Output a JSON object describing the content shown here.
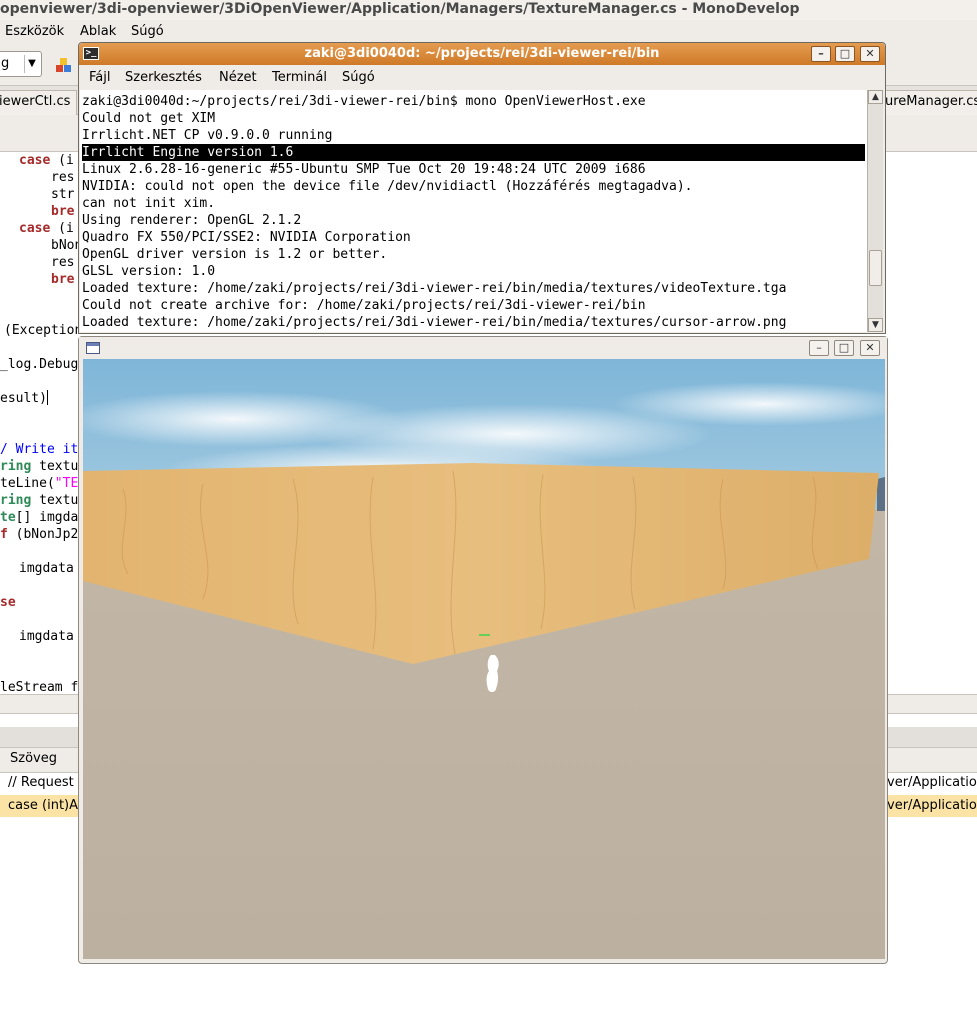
{
  "monodevelop": {
    "title": "openviewer/3di-openviewer/3DiOpenViewer/Application/Managers/TextureManager.cs - MonoDevelop",
    "menu": [
      "Eszközök",
      "Ablak",
      "Súgó"
    ],
    "config_combo": "g",
    "tabs": {
      "left": "iewerCtl.cs",
      "right": "ureManager.cs"
    },
    "pad": {
      "column": "Szöveg",
      "rows": [
        {
          "text": "// Request t",
          "right": "ver/Application"
        },
        {
          "text": "case (int)A",
          "right": "ver/Application"
        }
      ]
    }
  },
  "terminal": {
    "title": "zaki@3di0040d: ~/projects/rei/3di-viewer-rei/bin",
    "menu": [
      "Fájl",
      "Szerkesztés",
      "Nézet",
      "Terminál",
      "Súgó"
    ],
    "lines": [
      "zaki@3di0040d:~/projects/rei/3di-viewer-rei/bin$ mono OpenViewerHost.exe",
      "Could not get XIM",
      "Irrlicht.NET CP v0.9.0.0 running",
      "Irrlicht Engine version 1.6",
      "Linux 2.6.28-16-generic #55-Ubuntu SMP Tue Oct 20 19:48:24 UTC 2009 i686",
      "NVIDIA: could not open the device file /dev/nvidiactl (Hozzáférés megtagadva).",
      "can not init xim.",
      "Using renderer: OpenGL 2.1.2",
      "Quadro FX 550/PCI/SSE2: NVIDIA Corporation",
      "OpenGL driver version is 1.2 or better.",
      "GLSL version: 1.0",
      "Loaded texture: /home/zaki/projects/rei/3di-viewer-rei/bin/media/textures/videoTexture.tga",
      "Could not create archive for: /home/zaki/projects/rei/3di-viewer-rei/bin",
      "Loaded texture: /home/zaki/projects/rei/3di-viewer-rei/bin/media/textures/cursor-arrow.png"
    ],
    "highlighted_line": 3
  },
  "code": {
    "case1": "case",
    "case1_rest": " (i",
    "l_res1": "res",
    "l_str": "str",
    "l_bre1": "bre",
    "case2": "case",
    "case2_rest": " (i",
    "l_bnon": "bNon",
    "l_res2": "res",
    "l_bre2": "bre",
    "exception": "(Exception",
    "logdebug": "_log.Debug",
    "result": "esult)",
    "write_comment": "/ Write it",
    "string1": "ring",
    "string1_rest": " textu",
    "writeline": "teLine(",
    "writeline_str": "\"TE",
    "string2": "ring",
    "string2_rest": " textu",
    "byte": "te",
    "byte_rest": "[] imgda",
    "if": "f",
    "if_rest": " (bNonJp20",
    "imgdata1": "imgdata",
    "else": "se",
    "imgdata2": "imgdata",
    "filestream": "leStream f"
  }
}
